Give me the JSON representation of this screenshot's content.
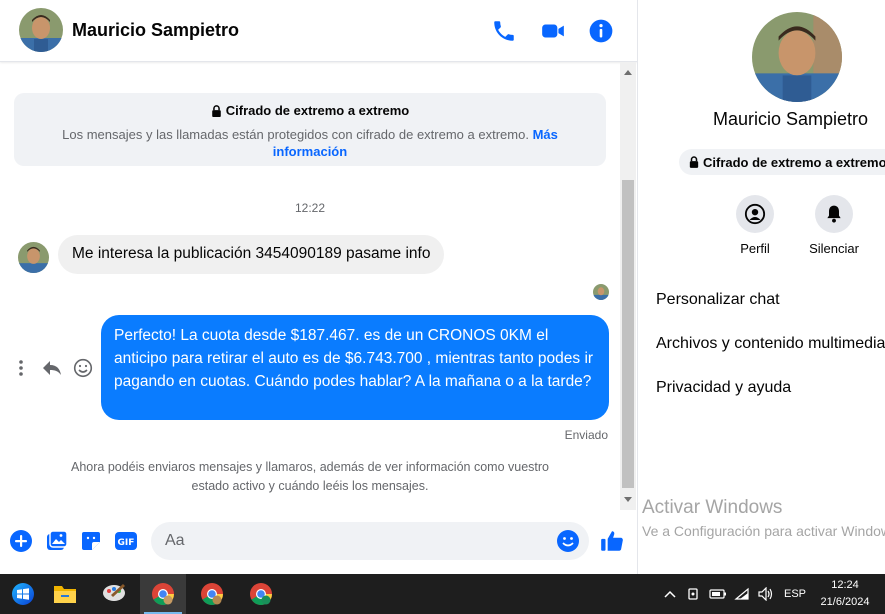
{
  "chat": {
    "header": {
      "name": "Mauricio Sampietro",
      "icons": [
        "phone-icon",
        "video-camera-icon",
        "info-icon"
      ]
    },
    "encryption_card": {
      "title": "Cifrado de extremo a extremo",
      "text": "Los mensajes y las llamadas están protegidos con cifrado de extremo a extremo.",
      "link": "Más información"
    },
    "time_separator": "12:22",
    "incoming_message": "Me interesa la publicación 3454090189 pasame info",
    "outgoing_message": "Perfecto! La cuota desde $187.467. es de un CRONOS 0KM el anticipo para retirar el auto es de $6.743.700 , mientras tanto podes ir pagando en cuotas. Cuándo podes hablar? A la mañana o a la tarde?",
    "outgoing_status": "Enviado",
    "info_note": "Ahora podéis enviaros mensajes y llamaros, además de ver información como vuestro estado activo y cuándo leéis los mensajes.",
    "composer": {
      "placeholder": "Aa",
      "value": ""
    }
  },
  "panel": {
    "name": "Mauricio Sampietro",
    "encryption_badge": "Cifrado de extremo a extremo",
    "actions": [
      {
        "label": "Perfil",
        "icon": "profile-icon"
      },
      {
        "label": "Silenciar",
        "icon": "bell-icon"
      }
    ],
    "menu": [
      "Personalizar chat",
      "Archivos y contenido multimedia",
      "Privacidad y ayuda"
    ]
  },
  "watermark": {
    "title": "Activar Windows",
    "subtitle": "Ve a Configuración para activar Windows."
  },
  "taskbar": {
    "apps": [
      "windows-start-icon",
      "file-explorer-icon",
      "paint-icon",
      "chrome-icon",
      "chrome-icon",
      "chrome-icon"
    ],
    "language": "ESP",
    "time": "12:24",
    "date": "21/6/2024"
  },
  "colors": {
    "accent": "#0866ff",
    "outgoing_bubble": "#0a7cff",
    "incoming_bubble": "#f0f0f0",
    "taskbar": "#1e1e1e"
  }
}
